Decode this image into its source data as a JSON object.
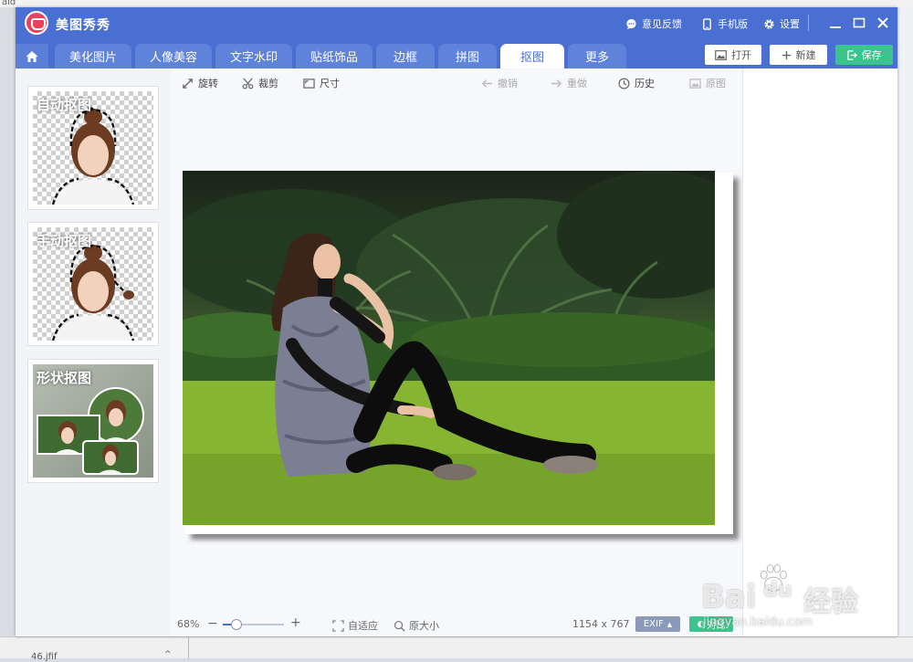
{
  "background": {
    "top_fragment": "aid",
    "taskbar_item": "46.jfif",
    "taskbar_chevron": "^"
  },
  "app": {
    "title": "美图秀秀",
    "brand_color": "#4a6fd2",
    "accent_color": "#3cc48d",
    "logo_color": "#e8425c"
  },
  "titlebar": {
    "feedback": "意见反馈",
    "mobile": "手机版",
    "settings": "设置"
  },
  "tabs": [
    {
      "label": "美化图片"
    },
    {
      "label": "人像美容"
    },
    {
      "label": "文字水印"
    },
    {
      "label": "贴纸饰品"
    },
    {
      "label": "边框"
    },
    {
      "label": "拼图"
    },
    {
      "label": "抠图",
      "active": true
    },
    {
      "label": "更多"
    }
  ],
  "actions": {
    "open": "打开",
    "new": "新建",
    "save": "保存"
  },
  "sidebar": {
    "cards": [
      {
        "label": "自动抠图"
      },
      {
        "label": "手动抠图"
      },
      {
        "label": "形状抠图"
      }
    ]
  },
  "toolbar": {
    "rotate": "旋转",
    "crop": "裁剪",
    "resize": "尺寸",
    "undo": "撤销",
    "redo": "重做",
    "history": "历史",
    "original": "原图"
  },
  "statusbar": {
    "zoom": "68%",
    "zoom_value": 0.22,
    "minus": "−",
    "plus": "+",
    "fit": "自适应",
    "actual_size": "原大小",
    "dimensions": "1154 x 767",
    "exif": "EXIF",
    "compare": "对比"
  },
  "watermark": {
    "brand": "Bai",
    "brand_du": "du",
    "cn": "经验",
    "url": "jingyan.baidu.com"
  }
}
